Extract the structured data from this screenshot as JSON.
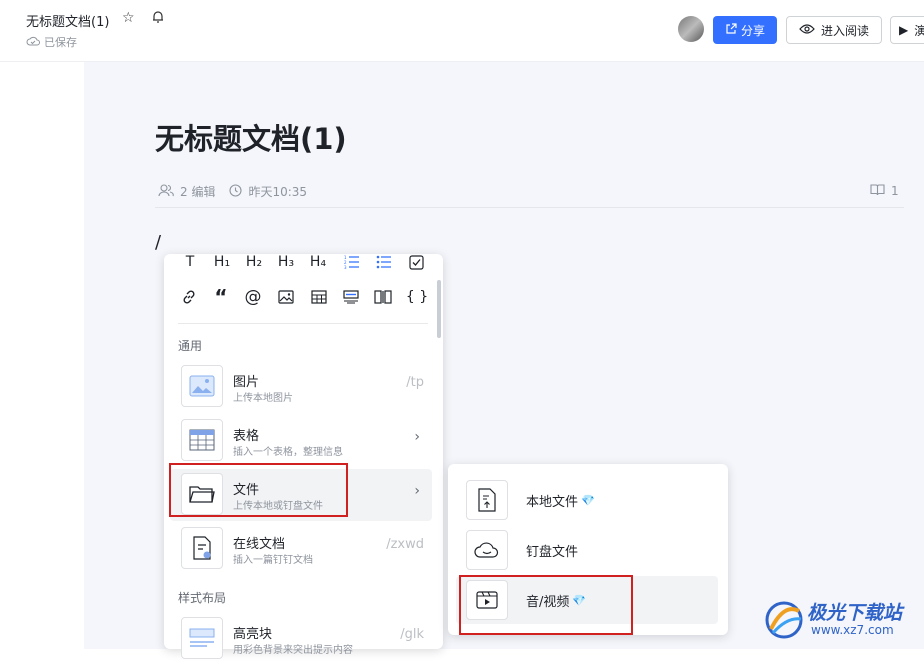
{
  "header": {
    "doc_title": "无标题文档(1)",
    "saved_text": "已保存",
    "share_label": "分享",
    "read_label": "进入阅读",
    "present_label": "演"
  },
  "document": {
    "heading": "无标题文档(1)",
    "editors": "2 编辑",
    "time": "昨天10:35",
    "comments": "1",
    "slash": "/"
  },
  "toolbar": {
    "row1": [
      "T",
      "H₁",
      "H₂",
      "H₃",
      "H₄"
    ],
    "row2": [
      "{ }"
    ]
  },
  "menu": {
    "section_general": "通用",
    "section_layout": "样式布局",
    "items": [
      {
        "title": "图片",
        "desc": "上传本地图片",
        "shortcut": "/tp"
      },
      {
        "title": "表格",
        "desc": "插入一个表格，整理信息"
      },
      {
        "title": "文件",
        "desc": "上传本地或钉盘文件"
      },
      {
        "title": "在线文档",
        "desc": "插入一篇钉钉文档",
        "shortcut": "/zxwd"
      },
      {
        "title": "高亮块",
        "desc": "用彩色背景来突出提示内容",
        "shortcut": "/glk"
      }
    ]
  },
  "submenu": {
    "items": [
      {
        "label": "本地文件",
        "premium": true
      },
      {
        "label": "钉盘文件",
        "premium": false
      },
      {
        "label": "音/视频",
        "premium": true
      }
    ]
  },
  "watermark": {
    "name": "极光下载站",
    "url": "www.xz7.com"
  },
  "colors": {
    "accent": "#3370ff",
    "highlight_box": "#d0201f",
    "canvas": "#f4f6fb"
  }
}
